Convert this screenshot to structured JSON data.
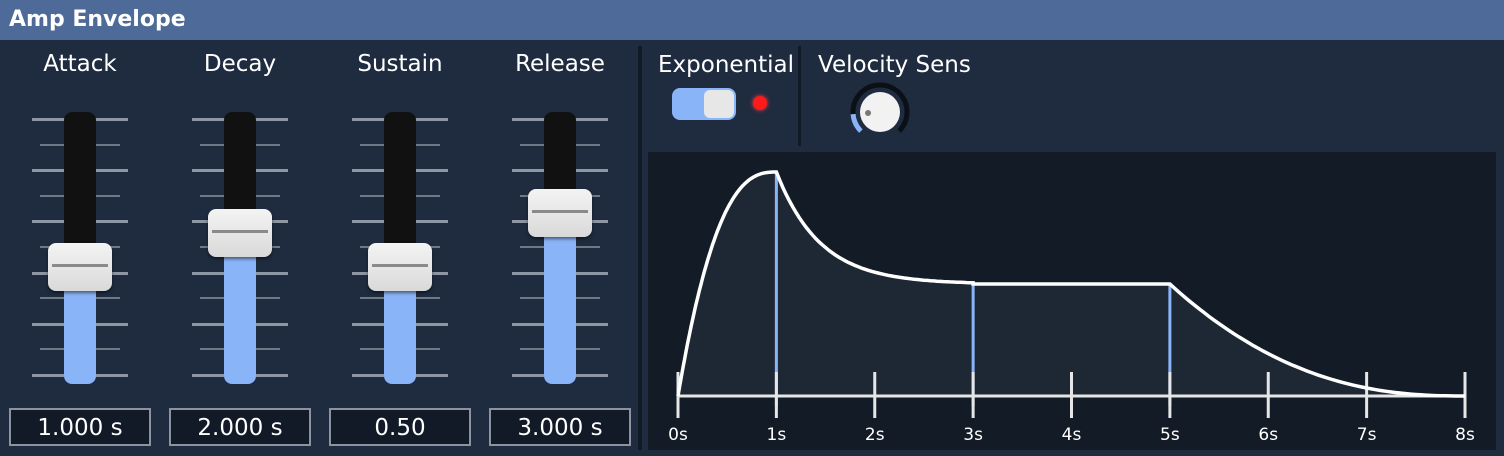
{
  "header": {
    "title": "Amp Envelope"
  },
  "sliders": [
    {
      "label": "Attack",
      "value": "1.000 s",
      "level": 0.46
    },
    {
      "label": "Decay",
      "value": "2.000 s",
      "level": 0.61
    },
    {
      "label": "Sustain",
      "value": "0.50",
      "level": 0.46
    },
    {
      "label": "Release",
      "value": "3.000 s",
      "level": 0.7
    }
  ],
  "exponential": {
    "label": "Exponential",
    "on": true
  },
  "velocity": {
    "label": "Velocity Sens",
    "level": 0.15
  },
  "chart_data": {
    "type": "line",
    "x_ticks": [
      "0s",
      "1s",
      "2s",
      "3s",
      "4s",
      "5s",
      "6s",
      "7s",
      "8s"
    ],
    "xlim": [
      0,
      8
    ],
    "ylim": [
      0,
      1
    ],
    "points": {
      "attack_end": 1,
      "decay_end": 3,
      "sustain_end": 5,
      "release_end": 8,
      "sustain_level": 0.5
    },
    "colors": {
      "line": "#ffffff",
      "markers": "#8ab4f8",
      "fill": "#1e2734"
    }
  },
  "colors": {
    "accent": "#8ab4f8",
    "header": "#4d6a98",
    "panel": "#1f2c40",
    "led": "#ff1a1a"
  }
}
